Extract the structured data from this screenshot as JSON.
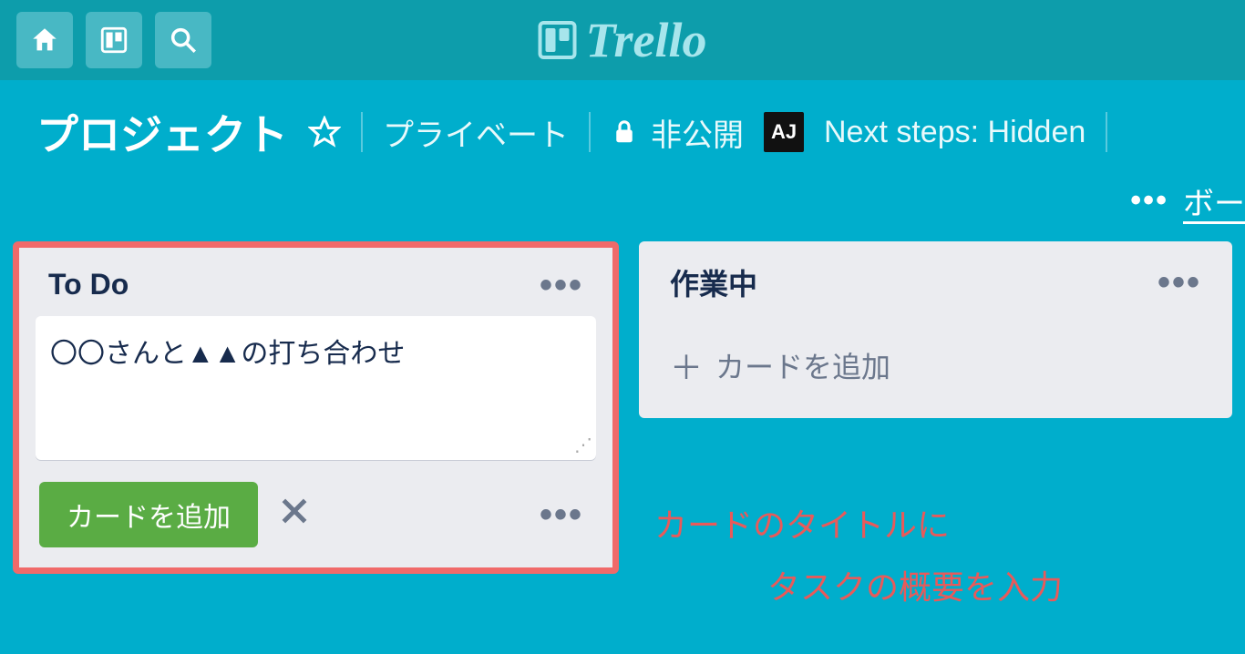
{
  "brand": {
    "name": "Trello"
  },
  "board": {
    "title": "プロジェクト",
    "privacy_label": "プライベート",
    "visibility_label": "非公開",
    "avatar_initials": "AJ",
    "next_steps_label": "Next steps: Hidden",
    "menu_label": "ボー"
  },
  "lists": {
    "todo": {
      "title": "To Do",
      "card_draft": "〇〇さんと▲▲の打ち合わせ",
      "add_button": "カードを追加"
    },
    "working": {
      "title": "作業中",
      "add_link": "カードを追加"
    }
  },
  "annotation": {
    "line1": "カードのタイトルに",
    "line2": "タスクの概要を入力"
  }
}
